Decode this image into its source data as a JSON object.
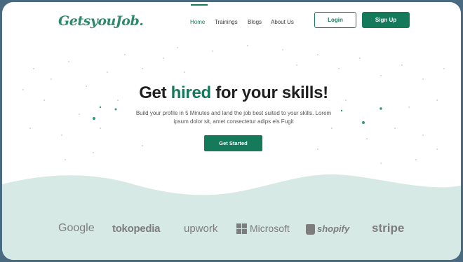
{
  "logo": {
    "text": "GetsyouJob."
  },
  "nav": {
    "home": "Home",
    "trainings": "Trainings",
    "blogs": "Blogs",
    "about": "About Us",
    "login": "Login",
    "signup": "Sign Up"
  },
  "hero": {
    "title_pre": "Get ",
    "title_highlight": "hired",
    "title_post": " for your skills!",
    "subtitle": "Build your profile in 5 Minutes and land the job best suited to your skills. Lorem ipsum dolor sit, amet consectetur adips els Fugit",
    "cta": "Get Started"
  },
  "brands": {
    "google": "Google",
    "tokopedia": "tokopedia",
    "upwork": "upwork",
    "microsoft": "Microsoft",
    "shopify": "shopify",
    "stripe": "stripe"
  },
  "colors": {
    "brand_green": "#157a5a",
    "wave": "#d6e9e4",
    "background_frame": "#4a6a82"
  }
}
